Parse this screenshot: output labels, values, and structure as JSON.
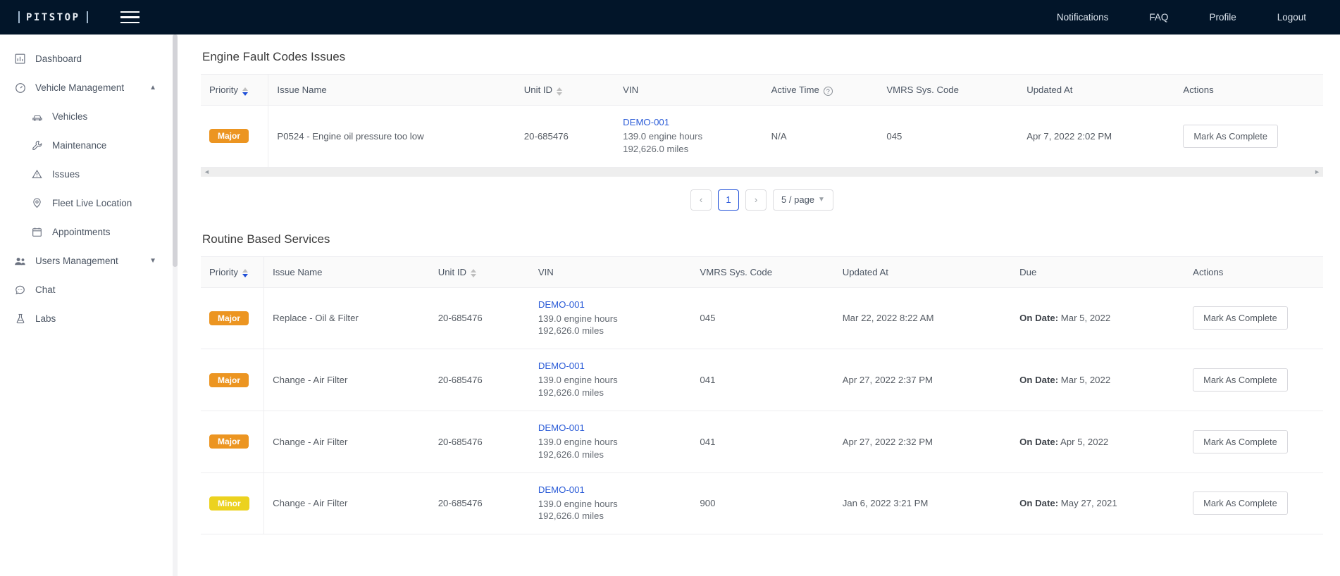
{
  "topbar": {
    "brand": "PITSTOP",
    "menu_icon": "hamburger-icon",
    "nav": [
      {
        "label": "Notifications"
      },
      {
        "label": "FAQ"
      },
      {
        "label": "Profile"
      },
      {
        "label": "Logout"
      }
    ]
  },
  "sidebar": {
    "items": [
      {
        "label": "Dashboard",
        "icon": "chart-bar-icon",
        "sub": false,
        "chevron": ""
      },
      {
        "label": "Vehicle Management",
        "icon": "gauge-icon",
        "sub": false,
        "chevron": "up"
      },
      {
        "label": "Vehicles",
        "icon": "car-icon",
        "sub": true,
        "chevron": ""
      },
      {
        "label": "Maintenance",
        "icon": "wrench-icon",
        "sub": true,
        "chevron": ""
      },
      {
        "label": "Issues",
        "icon": "warning-triangle-icon",
        "sub": true,
        "chevron": ""
      },
      {
        "label": "Fleet Live Location",
        "icon": "map-pin-icon",
        "sub": true,
        "chevron": ""
      },
      {
        "label": "Appointments",
        "icon": "calendar-icon",
        "sub": true,
        "chevron": ""
      },
      {
        "label": "Users Management",
        "icon": "users-icon",
        "sub": false,
        "chevron": "down"
      },
      {
        "label": "Chat",
        "icon": "chat-bubble-icon",
        "sub": false,
        "chevron": ""
      },
      {
        "label": "Labs",
        "icon": "flask-icon",
        "sub": false,
        "chevron": ""
      }
    ]
  },
  "colors": {
    "topbar_bg": "#021529",
    "major_badge": "#ec9521",
    "minor_badge": "#ecd21f",
    "link_blue": "#2a5bd7",
    "active_page_blue": "#1f4fd8"
  },
  "engine_faults": {
    "title": "Engine Fault Codes Issues",
    "columns": [
      {
        "label": "Priority",
        "sortable": true,
        "sort_active": "desc"
      },
      {
        "label": "Issue Name",
        "sortable": false
      },
      {
        "label": "Unit ID",
        "sortable": true,
        "sort_active": "none"
      },
      {
        "label": "VIN",
        "sortable": false
      },
      {
        "label": "Active Time",
        "sortable": false,
        "help": true
      },
      {
        "label": "VMRS Sys. Code",
        "sortable": false
      },
      {
        "label": "Updated At",
        "sortable": false
      },
      {
        "label": "Actions",
        "sortable": false
      }
    ],
    "rows": [
      {
        "priority": "Major",
        "priority_class": "major",
        "issue_name": "P0524 - Engine oil pressure too low",
        "unit_id": "20-685476",
        "vin": "DEMO-001",
        "vin_hours": "139.0 engine hours",
        "vin_miles": "192,626.0 miles",
        "active_time": "N/A",
        "vmrs": "045",
        "updated_at": "Apr 7, 2022 2:02 PM",
        "action": "Mark As Complete"
      }
    ],
    "pagination": {
      "prev": "‹",
      "pages": [
        "1"
      ],
      "current": "1",
      "next": "›",
      "page_size": "5 / page"
    }
  },
  "routine_services": {
    "title": "Routine Based Services",
    "columns": [
      {
        "label": "Priority",
        "sortable": true,
        "sort_active": "desc"
      },
      {
        "label": "Issue Name",
        "sortable": false
      },
      {
        "label": "Unit ID",
        "sortable": true,
        "sort_active": "none"
      },
      {
        "label": "VIN",
        "sortable": false
      },
      {
        "label": "VMRS Sys. Code",
        "sortable": false
      },
      {
        "label": "Updated At",
        "sortable": false
      },
      {
        "label": "Due",
        "sortable": false
      },
      {
        "label": "Actions",
        "sortable": false
      }
    ],
    "due_prefix": "On Date:",
    "rows": [
      {
        "priority": "Major",
        "priority_class": "major",
        "issue_name": "Replace - Oil & Filter",
        "unit_id": "20-685476",
        "vin": "DEMO-001",
        "vin_hours": "139.0 engine hours",
        "vin_miles": "192,626.0 miles",
        "vmrs": "045",
        "updated_at": "Mar 22, 2022 8:22 AM",
        "due": "Mar 5, 2022",
        "action": "Mark As Complete"
      },
      {
        "priority": "Major",
        "priority_class": "major",
        "issue_name": "Change - Air Filter",
        "unit_id": "20-685476",
        "vin": "DEMO-001",
        "vin_hours": "139.0 engine hours",
        "vin_miles": "192,626.0 miles",
        "vmrs": "041",
        "updated_at": "Apr 27, 2022 2:37 PM",
        "due": "Mar 5, 2022",
        "action": "Mark As Complete"
      },
      {
        "priority": "Major",
        "priority_class": "major",
        "issue_name": "Change - Air Filter",
        "unit_id": "20-685476",
        "vin": "DEMO-001",
        "vin_hours": "139.0 engine hours",
        "vin_miles": "192,626.0 miles",
        "vmrs": "041",
        "updated_at": "Apr 27, 2022 2:32 PM",
        "due": "Apr 5, 2022",
        "action": "Mark As Complete"
      },
      {
        "priority": "Minor",
        "priority_class": "minor",
        "issue_name": "Change - Air Filter",
        "unit_id": "20-685476",
        "vin": "DEMO-001",
        "vin_hours": "139.0 engine hours",
        "vin_miles": "192,626.0 miles",
        "vmrs": "900",
        "updated_at": "Jan 6, 2022 3:21 PM",
        "due": "May 27, 2021",
        "action": "Mark As Complete"
      }
    ]
  }
}
